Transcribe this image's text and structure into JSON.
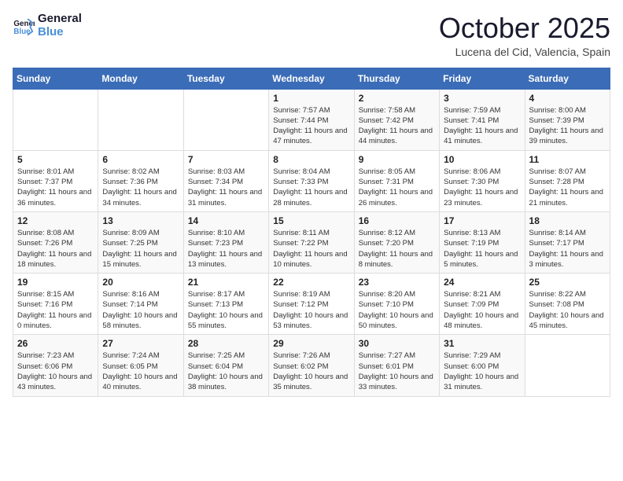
{
  "header": {
    "logo_general": "General",
    "logo_blue": "Blue",
    "month": "October 2025",
    "location": "Lucena del Cid, Valencia, Spain"
  },
  "weekdays": [
    "Sunday",
    "Monday",
    "Tuesday",
    "Wednesday",
    "Thursday",
    "Friday",
    "Saturday"
  ],
  "weeks": [
    [
      {
        "day": "",
        "sunrise": "",
        "sunset": "",
        "daylight": ""
      },
      {
        "day": "",
        "sunrise": "",
        "sunset": "",
        "daylight": ""
      },
      {
        "day": "",
        "sunrise": "",
        "sunset": "",
        "daylight": ""
      },
      {
        "day": "1",
        "sunrise": "Sunrise: 7:57 AM",
        "sunset": "Sunset: 7:44 PM",
        "daylight": "Daylight: 11 hours and 47 minutes."
      },
      {
        "day": "2",
        "sunrise": "Sunrise: 7:58 AM",
        "sunset": "Sunset: 7:42 PM",
        "daylight": "Daylight: 11 hours and 44 minutes."
      },
      {
        "day": "3",
        "sunrise": "Sunrise: 7:59 AM",
        "sunset": "Sunset: 7:41 PM",
        "daylight": "Daylight: 11 hours and 41 minutes."
      },
      {
        "day": "4",
        "sunrise": "Sunrise: 8:00 AM",
        "sunset": "Sunset: 7:39 PM",
        "daylight": "Daylight: 11 hours and 39 minutes."
      }
    ],
    [
      {
        "day": "5",
        "sunrise": "Sunrise: 8:01 AM",
        "sunset": "Sunset: 7:37 PM",
        "daylight": "Daylight: 11 hours and 36 minutes."
      },
      {
        "day": "6",
        "sunrise": "Sunrise: 8:02 AM",
        "sunset": "Sunset: 7:36 PM",
        "daylight": "Daylight: 11 hours and 34 minutes."
      },
      {
        "day": "7",
        "sunrise": "Sunrise: 8:03 AM",
        "sunset": "Sunset: 7:34 PM",
        "daylight": "Daylight: 11 hours and 31 minutes."
      },
      {
        "day": "8",
        "sunrise": "Sunrise: 8:04 AM",
        "sunset": "Sunset: 7:33 PM",
        "daylight": "Daylight: 11 hours and 28 minutes."
      },
      {
        "day": "9",
        "sunrise": "Sunrise: 8:05 AM",
        "sunset": "Sunset: 7:31 PM",
        "daylight": "Daylight: 11 hours and 26 minutes."
      },
      {
        "day": "10",
        "sunrise": "Sunrise: 8:06 AM",
        "sunset": "Sunset: 7:30 PM",
        "daylight": "Daylight: 11 hours and 23 minutes."
      },
      {
        "day": "11",
        "sunrise": "Sunrise: 8:07 AM",
        "sunset": "Sunset: 7:28 PM",
        "daylight": "Daylight: 11 hours and 21 minutes."
      }
    ],
    [
      {
        "day": "12",
        "sunrise": "Sunrise: 8:08 AM",
        "sunset": "Sunset: 7:26 PM",
        "daylight": "Daylight: 11 hours and 18 minutes."
      },
      {
        "day": "13",
        "sunrise": "Sunrise: 8:09 AM",
        "sunset": "Sunset: 7:25 PM",
        "daylight": "Daylight: 11 hours and 15 minutes."
      },
      {
        "day": "14",
        "sunrise": "Sunrise: 8:10 AM",
        "sunset": "Sunset: 7:23 PM",
        "daylight": "Daylight: 11 hours and 13 minutes."
      },
      {
        "day": "15",
        "sunrise": "Sunrise: 8:11 AM",
        "sunset": "Sunset: 7:22 PM",
        "daylight": "Daylight: 11 hours and 10 minutes."
      },
      {
        "day": "16",
        "sunrise": "Sunrise: 8:12 AM",
        "sunset": "Sunset: 7:20 PM",
        "daylight": "Daylight: 11 hours and 8 minutes."
      },
      {
        "day": "17",
        "sunrise": "Sunrise: 8:13 AM",
        "sunset": "Sunset: 7:19 PM",
        "daylight": "Daylight: 11 hours and 5 minutes."
      },
      {
        "day": "18",
        "sunrise": "Sunrise: 8:14 AM",
        "sunset": "Sunset: 7:17 PM",
        "daylight": "Daylight: 11 hours and 3 minutes."
      }
    ],
    [
      {
        "day": "19",
        "sunrise": "Sunrise: 8:15 AM",
        "sunset": "Sunset: 7:16 PM",
        "daylight": "Daylight: 11 hours and 0 minutes."
      },
      {
        "day": "20",
        "sunrise": "Sunrise: 8:16 AM",
        "sunset": "Sunset: 7:14 PM",
        "daylight": "Daylight: 10 hours and 58 minutes."
      },
      {
        "day": "21",
        "sunrise": "Sunrise: 8:17 AM",
        "sunset": "Sunset: 7:13 PM",
        "daylight": "Daylight: 10 hours and 55 minutes."
      },
      {
        "day": "22",
        "sunrise": "Sunrise: 8:19 AM",
        "sunset": "Sunset: 7:12 PM",
        "daylight": "Daylight: 10 hours and 53 minutes."
      },
      {
        "day": "23",
        "sunrise": "Sunrise: 8:20 AM",
        "sunset": "Sunset: 7:10 PM",
        "daylight": "Daylight: 10 hours and 50 minutes."
      },
      {
        "day": "24",
        "sunrise": "Sunrise: 8:21 AM",
        "sunset": "Sunset: 7:09 PM",
        "daylight": "Daylight: 10 hours and 48 minutes."
      },
      {
        "day": "25",
        "sunrise": "Sunrise: 8:22 AM",
        "sunset": "Sunset: 7:08 PM",
        "daylight": "Daylight: 10 hours and 45 minutes."
      }
    ],
    [
      {
        "day": "26",
        "sunrise": "Sunrise: 7:23 AM",
        "sunset": "Sunset: 6:06 PM",
        "daylight": "Daylight: 10 hours and 43 minutes."
      },
      {
        "day": "27",
        "sunrise": "Sunrise: 7:24 AM",
        "sunset": "Sunset: 6:05 PM",
        "daylight": "Daylight: 10 hours and 40 minutes."
      },
      {
        "day": "28",
        "sunrise": "Sunrise: 7:25 AM",
        "sunset": "Sunset: 6:04 PM",
        "daylight": "Daylight: 10 hours and 38 minutes."
      },
      {
        "day": "29",
        "sunrise": "Sunrise: 7:26 AM",
        "sunset": "Sunset: 6:02 PM",
        "daylight": "Daylight: 10 hours and 35 minutes."
      },
      {
        "day": "30",
        "sunrise": "Sunrise: 7:27 AM",
        "sunset": "Sunset: 6:01 PM",
        "daylight": "Daylight: 10 hours and 33 minutes."
      },
      {
        "day": "31",
        "sunrise": "Sunrise: 7:29 AM",
        "sunset": "Sunset: 6:00 PM",
        "daylight": "Daylight: 10 hours and 31 minutes."
      },
      {
        "day": "",
        "sunrise": "",
        "sunset": "",
        "daylight": ""
      }
    ]
  ]
}
